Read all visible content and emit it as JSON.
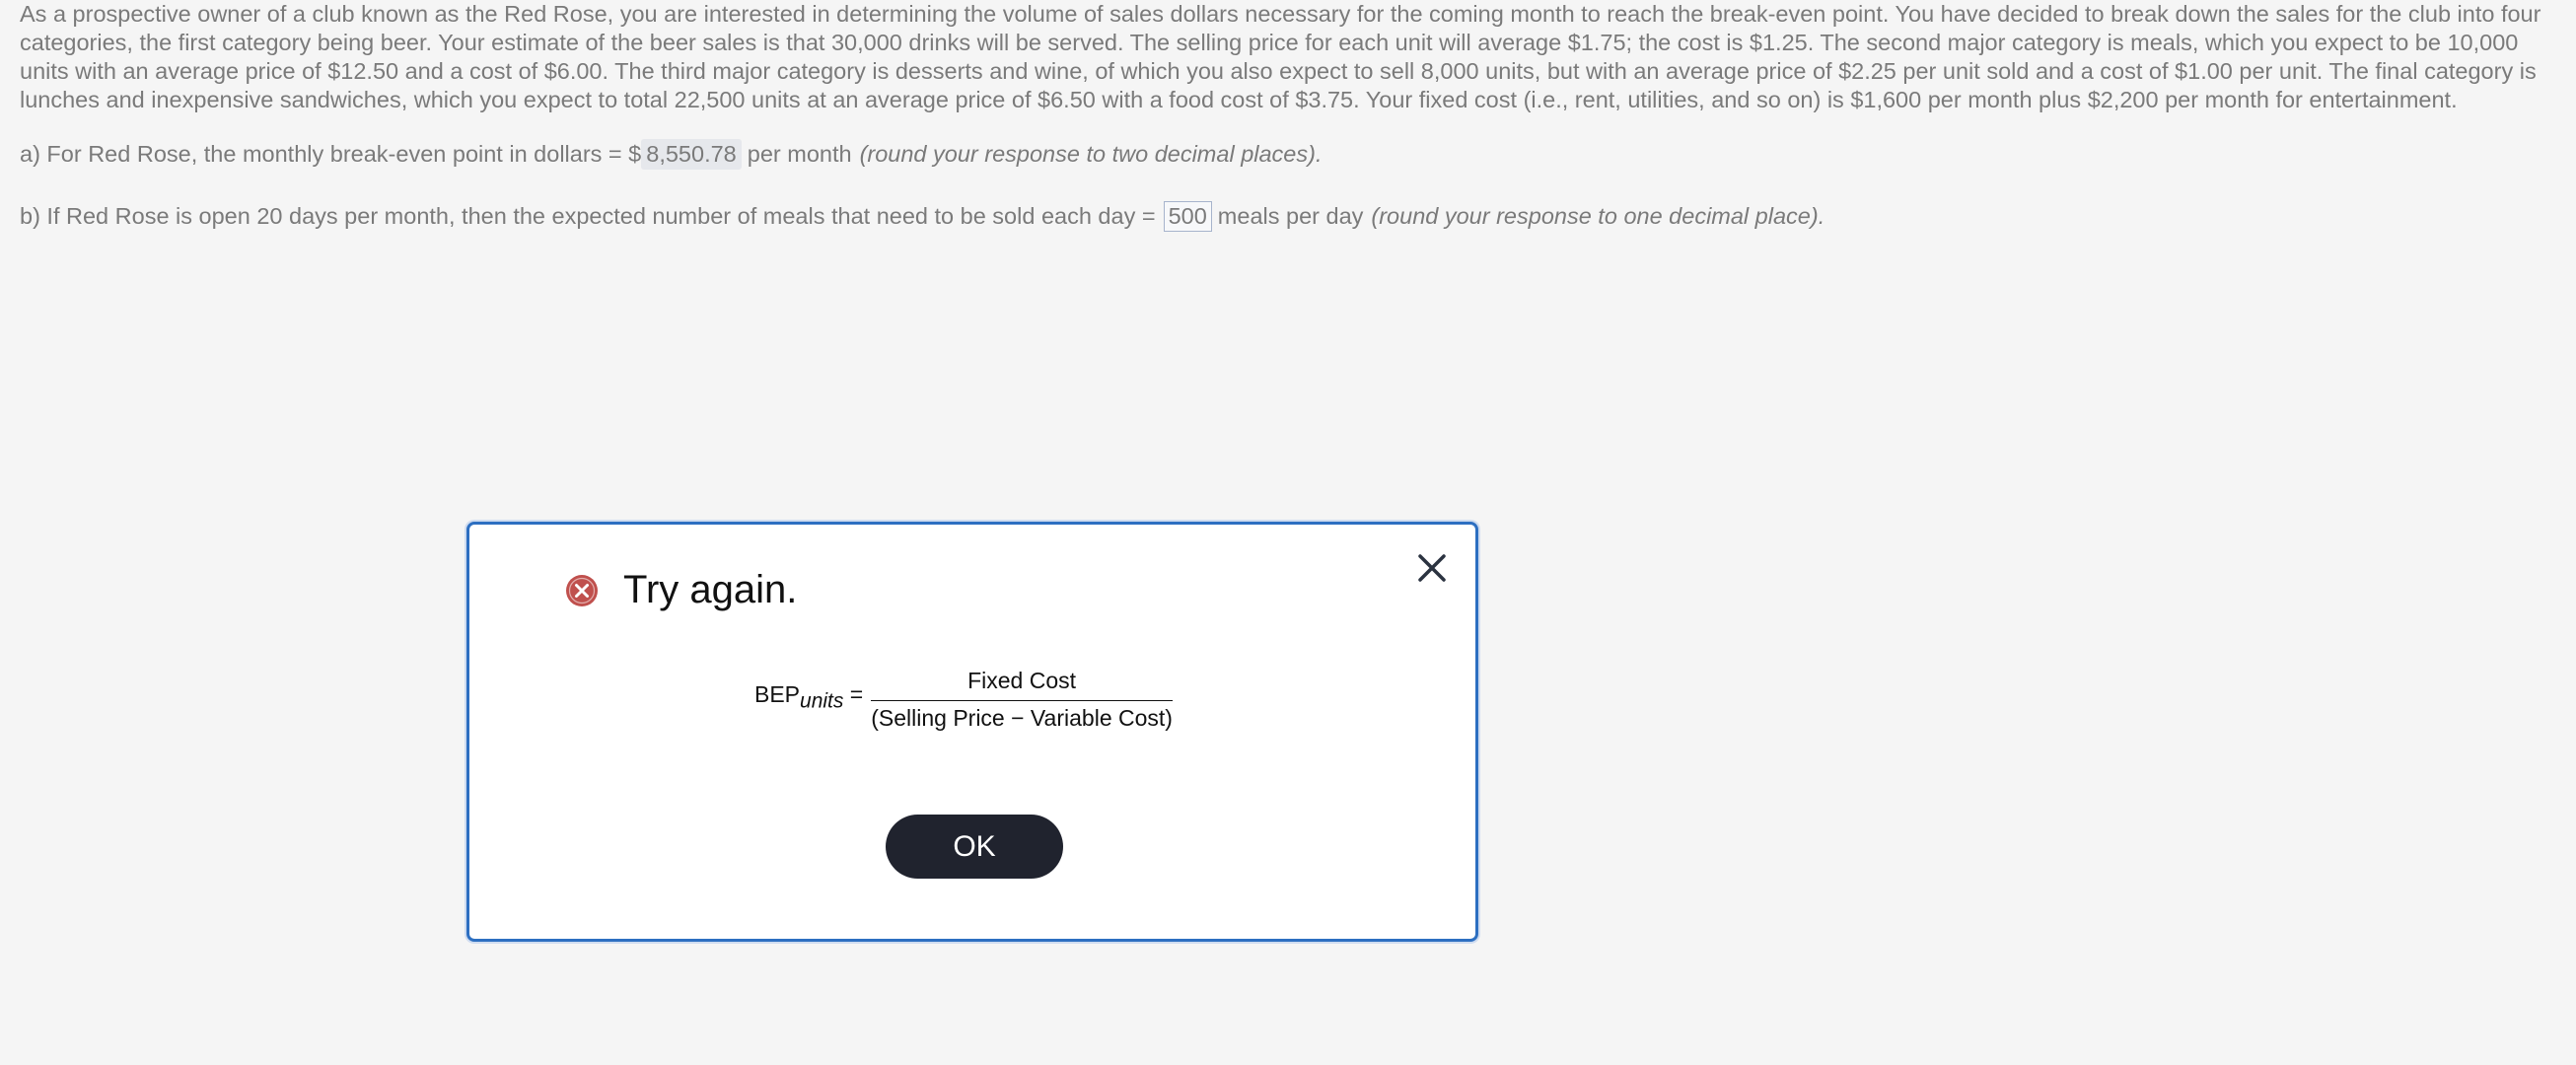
{
  "problem": {
    "text": "As a prospective owner of a club known as the Red Rose, you are interested in determining the volume of sales dollars necessary for the coming month to reach the break-even point. You have decided to break down the sales for the club into four categories, the first category being beer. Your estimate of the beer sales is that 30,000 drinks will be served. The selling price for each unit will average $1.75; the cost is $1.25. The second major category is meals, which you expect to be 10,000 units with an average price of $12.50 and a cost of $6.00. The third major category is desserts and wine, of which you also expect to sell 8,000 units, but with an average price of $2.25 per unit sold and a cost of $1.00 per unit. The final category is lunches and inexpensive sandwiches, which you expect to total 22,500 units at an average price of $6.50 with a food cost of $3.75. Your fixed cost (i.e., rent, utilities, and so on) is $1,600 per month plus $2,200 per month for entertainment."
  },
  "question_a": {
    "prefix": "a) For Red Rose, the monthly break-even point in dollars = $",
    "answer": "8,550.78",
    "suffix": "per month",
    "note": "(round your response to two decimal places)."
  },
  "question_b": {
    "prefix": "b) If Red Rose is open 20 days per month, then the expected number of meals that need to be sold each day =",
    "answer": "500",
    "suffix": "meals per day",
    "note": "(round your response to one decimal place)."
  },
  "dialog": {
    "title": "Try again.",
    "formula": {
      "lhs": "BEP",
      "lhs_sub": "units",
      "equals": "=",
      "numerator": "Fixed Cost",
      "denominator": "(Selling Price  −  Variable Cost)"
    },
    "ok_label": "OK",
    "colors": {
      "border": "#2d6fc1",
      "error_icon": "#c0504d",
      "ok_button": "#20232e"
    },
    "icons": {
      "status": "error-x-circle-icon",
      "close": "close-x-icon"
    }
  }
}
